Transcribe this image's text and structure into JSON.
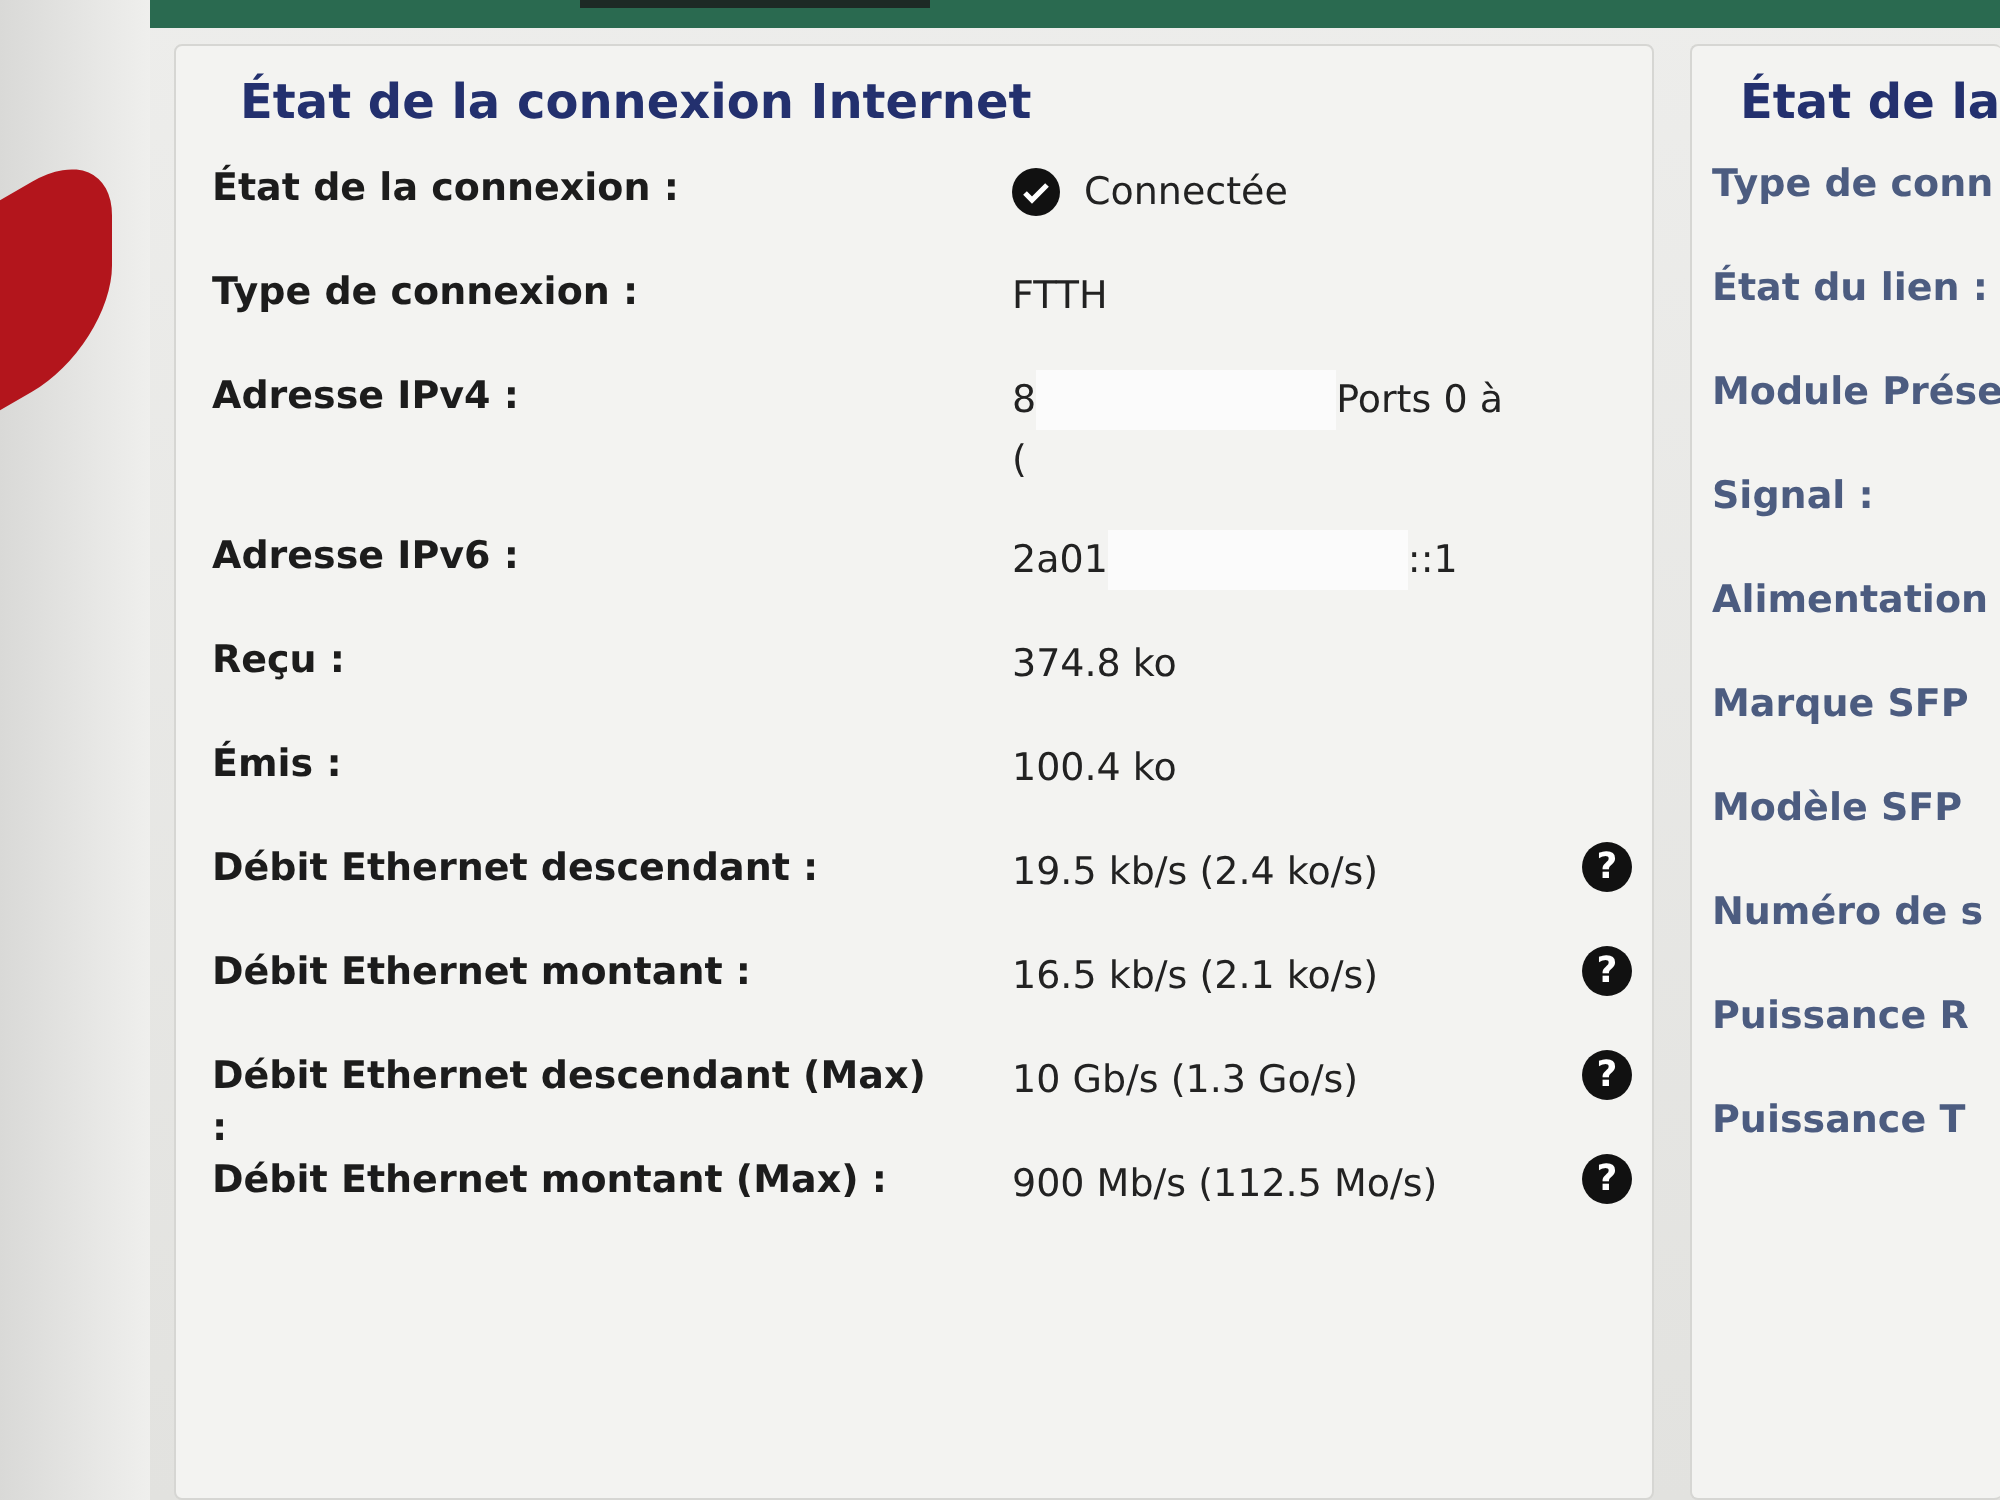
{
  "main_panel": {
    "title": "État de la connexion Internet",
    "rows": [
      {
        "label": "État de la connexion :",
        "lines": [
          [
            {
              "kind": "status",
              "connected": true,
              "text": "Connectée"
            }
          ]
        ]
      },
      {
        "label": "Type de connexion :",
        "lines": [
          [
            {
              "kind": "text",
              "text": "FTTH"
            }
          ]
        ]
      },
      {
        "label": "Adresse IPv4 :",
        "lines": [
          [
            {
              "kind": "text",
              "text": "8"
            },
            {
              "kind": "redacted"
            },
            {
              "kind": "text",
              "text": "Ports 0 à"
            }
          ],
          [
            {
              "kind": "text",
              "text": "("
            }
          ]
        ]
      },
      {
        "label": "Adresse IPv6 :",
        "lines": [
          [
            {
              "kind": "text",
              "text": "2a01"
            },
            {
              "kind": "redacted"
            },
            {
              "kind": "text",
              "text": "::1"
            }
          ]
        ]
      },
      {
        "label": "Reçu :",
        "lines": [
          [
            {
              "kind": "text",
              "text": "374.8 ko"
            }
          ]
        ]
      },
      {
        "label": "Émis :",
        "lines": [
          [
            {
              "kind": "text",
              "text": "100.4 ko"
            }
          ]
        ]
      },
      {
        "label": "Débit Ethernet descendant :",
        "lines": [
          [
            {
              "kind": "text",
              "text": "19.5 kb/s (2.4 ko/s)"
            }
          ]
        ],
        "help": "?"
      },
      {
        "label": "Débit Ethernet montant :",
        "lines": [
          [
            {
              "kind": "text",
              "text": "16.5 kb/s (2.1 ko/s)"
            }
          ]
        ],
        "help": "?"
      },
      {
        "label": "Débit Ethernet descendant (Max) :",
        "lines": [
          [
            {
              "kind": "text",
              "text": "10 Gb/s (1.3 Go/s)"
            }
          ]
        ],
        "help": "?"
      },
      {
        "label": "Débit Ethernet montant (Max) :",
        "lines": [
          [
            {
              "kind": "text",
              "text": "900 Mb/s (112.5 Mo/s)"
            }
          ]
        ],
        "help": "?"
      }
    ]
  },
  "side_panel": {
    "title": "État de la",
    "labels": [
      "Type de conn",
      "État du lien :",
      "Module Prése",
      "Signal :",
      "Alimentation",
      "Marque SFP",
      "Modèle SFP",
      "Numéro de s",
      "Puissance R",
      "Puissance T"
    ]
  }
}
